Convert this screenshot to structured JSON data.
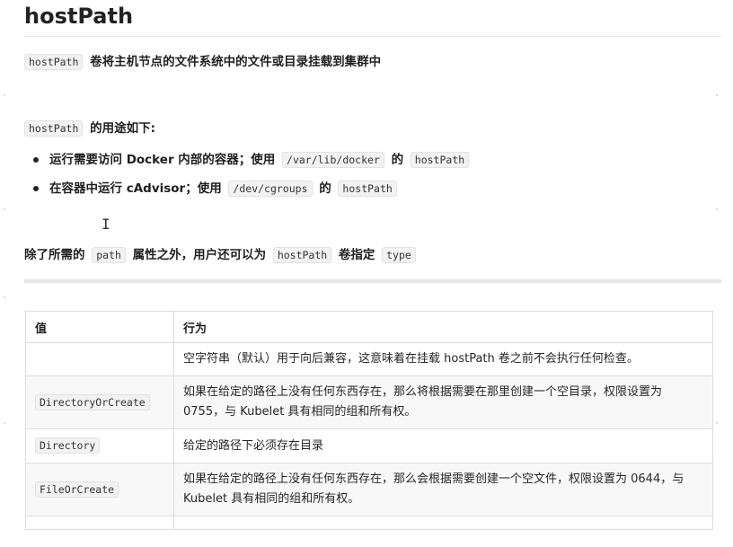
{
  "title": "hostPath",
  "intro": {
    "code": "hostPath",
    "text": "卷将主机节点的文件系统中的文件或目录挂载到集群中"
  },
  "uses": {
    "code": "hostPath",
    "text": "的用途如下:"
  },
  "bullets": [
    {
      "text": "运行需要访问 Docker 内部的容器；使用",
      "code1": "/var/lib/docker",
      "mid": "的",
      "code2": "hostPath"
    },
    {
      "text": "在容器中运行 cAdvisor；使用",
      "code1": "/dev/cgroups",
      "mid": "的",
      "code2": "hostPath"
    }
  ],
  "type_note": {
    "prefix": "除了所需的",
    "code1": "path",
    "mid1": "属性之外，用户还可以为",
    "code2": "hostPath",
    "mid2": "卷指定",
    "code3": "type"
  },
  "table": {
    "headers": [
      "值",
      "行为"
    ],
    "rows": [
      {
        "value": "",
        "behavior": "空字符串（默认）用于向后兼容，这意味着在挂载 hostPath 卷之前不会执行任何检查。"
      },
      {
        "value": "DirectoryOrCreate",
        "behavior": "如果在给定的路径上没有任何东西存在，那么将根据需要在那里创建一个空目录，权限设置为 0755，与 Kubelet 具有相同的组和所有权。"
      },
      {
        "value": "Directory",
        "behavior": "给定的路径下必须存在目录"
      },
      {
        "value": "FileOrCreate",
        "behavior": "如果在给定的路径上没有任何东西存在，那么会根据需要创建一个空文件，权限设置为 0644，与 Kubelet 具有相同的组和所有权。"
      }
    ]
  }
}
